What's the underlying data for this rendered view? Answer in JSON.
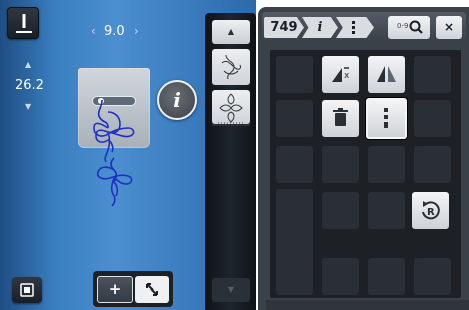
{
  "editor": {
    "stitch_width": "9.0",
    "stitch_length": "26.2",
    "arrow_left": "‹",
    "arrow_right": "›",
    "arrow_up": "▲",
    "arrow_down": "▼",
    "info_label": "i",
    "add_label": "+",
    "stitch_color": "#1f2fc4"
  },
  "column": {
    "up_arrow": "▲",
    "down_arrow": "▼",
    "items": [
      {
        "icon": "stitch-thumbnail-1-icon"
      },
      {
        "icon": "stitch-thumbnail-2-icon"
      }
    ]
  },
  "panel": {
    "breadcrumb": {
      "pattern_number": "749",
      "info_label": "i"
    },
    "zoom_label": "0-9",
    "close_label": "×",
    "functions": [
      {
        "name": "mirror-vertical-icon",
        "active": true
      },
      {
        "name": "mirror-horizontal-icon",
        "active": true
      },
      {
        "name": "delete-icon",
        "active": true
      },
      {
        "name": "vertical-dots-icon",
        "active": true,
        "selected": true
      },
      {
        "name": "repeat-r-icon",
        "active": true
      }
    ]
  }
}
